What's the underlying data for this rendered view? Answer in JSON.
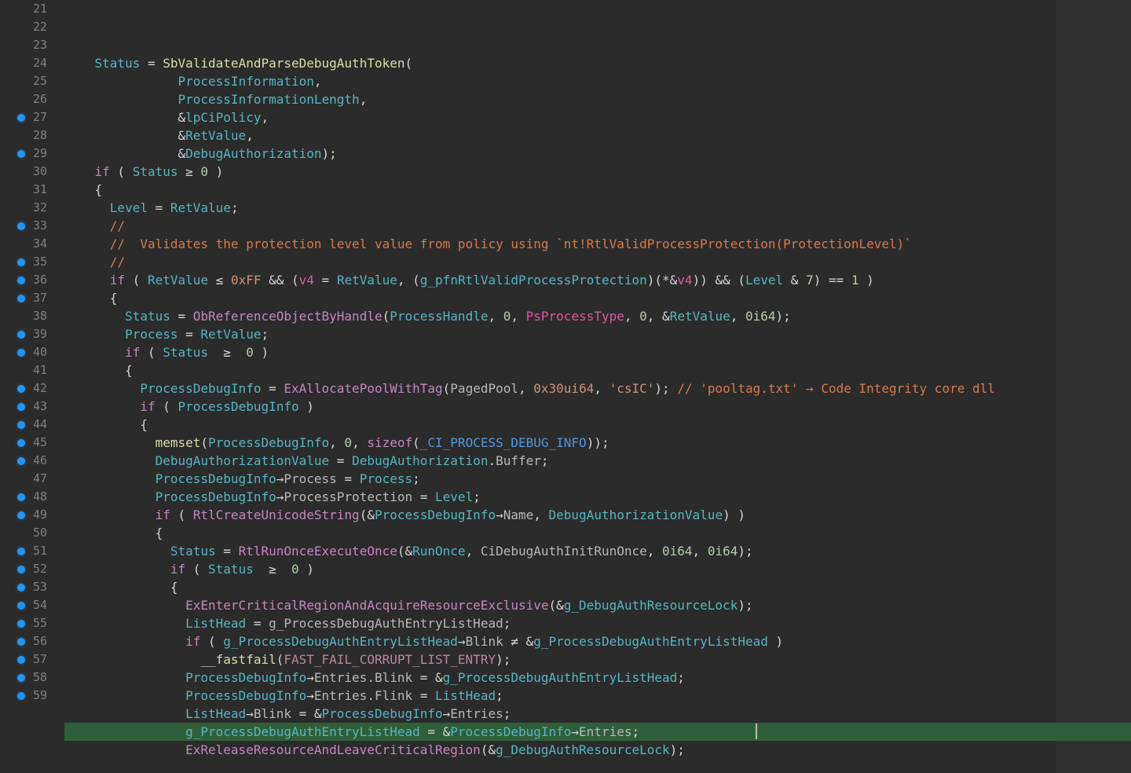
{
  "editor": {
    "firstLine": 21,
    "highlightedLine": 58,
    "lines": [
      {
        "n": 21,
        "bp": false,
        "tokens": [
          [
            "    ",
            "c-default"
          ],
          [
            "Status",
            "c-id"
          ],
          [
            " = ",
            "c-op"
          ],
          [
            "SbValidateAndParseDebugAuthToken",
            "c-fn"
          ],
          [
            "(",
            "c-white"
          ]
        ]
      },
      {
        "n": 22,
        "bp": false,
        "tokens": [
          [
            "               ",
            "c-default"
          ],
          [
            "ProcessInformation",
            "c-id"
          ],
          [
            ",",
            "c-white"
          ]
        ]
      },
      {
        "n": 23,
        "bp": false,
        "tokens": [
          [
            "               ",
            "c-default"
          ],
          [
            "ProcessInformationLength",
            "c-id"
          ],
          [
            ",",
            "c-white"
          ]
        ]
      },
      {
        "n": 24,
        "bp": false,
        "tokens": [
          [
            "               &",
            "c-white"
          ],
          [
            "lpCiPolicy",
            "c-id"
          ],
          [
            ",",
            "c-white"
          ]
        ]
      },
      {
        "n": 25,
        "bp": false,
        "tokens": [
          [
            "               &",
            "c-white"
          ],
          [
            "RetValue",
            "c-id"
          ],
          [
            ",",
            "c-white"
          ]
        ]
      },
      {
        "n": 26,
        "bp": false,
        "tokens": [
          [
            "               &",
            "c-white"
          ],
          [
            "DebugAuthorization",
            "c-id"
          ],
          [
            ");",
            "c-white"
          ]
        ]
      },
      {
        "n": 27,
        "bp": true,
        "tokens": [
          [
            "    ",
            "c-default"
          ],
          [
            "if",
            "c-kw"
          ],
          [
            " ( ",
            "c-white"
          ],
          [
            "Status",
            "c-id"
          ],
          [
            " ≥ ",
            "c-op"
          ],
          [
            "0",
            "c-num"
          ],
          [
            " )",
            "c-white"
          ]
        ]
      },
      {
        "n": 28,
        "bp": false,
        "tokens": [
          [
            "    {",
            "c-white"
          ]
        ]
      },
      {
        "n": 29,
        "bp": true,
        "tokens": [
          [
            "      ",
            "c-default"
          ],
          [
            "Level",
            "c-id"
          ],
          [
            " = ",
            "c-op"
          ],
          [
            "RetValue",
            "c-id"
          ],
          [
            ";",
            "c-white"
          ]
        ]
      },
      {
        "n": 30,
        "bp": false,
        "tokens": [
          [
            "      ",
            "c-default"
          ],
          [
            "//",
            "c-cmt2"
          ]
        ]
      },
      {
        "n": 31,
        "bp": false,
        "tokens": [
          [
            "      ",
            "c-default"
          ],
          [
            "//  Validates the protection level value from policy using `nt!RtlValidProcessProtection(ProtectionLevel)`",
            "c-cmt2"
          ]
        ]
      },
      {
        "n": 32,
        "bp": false,
        "tokens": [
          [
            "      ",
            "c-default"
          ],
          [
            "//",
            "c-cmt2"
          ]
        ]
      },
      {
        "n": 33,
        "bp": true,
        "tokens": [
          [
            "      ",
            "c-default"
          ],
          [
            "if",
            "c-kw"
          ],
          [
            " ( ",
            "c-white"
          ],
          [
            "RetValue",
            "c-id"
          ],
          [
            " ≤ ",
            "c-op"
          ],
          [
            "0xFF",
            "c-hex"
          ],
          [
            " && (",
            "c-white"
          ],
          [
            "v4",
            "c-var"
          ],
          [
            " = ",
            "c-op"
          ],
          [
            "RetValue",
            "c-id"
          ],
          [
            ", (",
            "c-white"
          ],
          [
            "g_pfnRtlValidProcessProtection",
            "c-id"
          ],
          [
            ")(*&",
            "c-white"
          ],
          [
            "v4",
            "c-var"
          ],
          [
            ")) && (",
            "c-white"
          ],
          [
            "Level",
            "c-id"
          ],
          [
            " & ",
            "c-op"
          ],
          [
            "7",
            "c-num"
          ],
          [
            ") == ",
            "c-op"
          ],
          [
            "1",
            "c-num"
          ],
          [
            " )",
            "c-white"
          ]
        ]
      },
      {
        "n": 34,
        "bp": false,
        "tokens": [
          [
            "      {",
            "c-white"
          ]
        ]
      },
      {
        "n": 35,
        "bp": true,
        "tokens": [
          [
            "        ",
            "c-default"
          ],
          [
            "Status",
            "c-id"
          ],
          [
            " = ",
            "c-op"
          ],
          [
            "ObReferenceObjectByHandle",
            "c-fnp"
          ],
          [
            "(",
            "c-white"
          ],
          [
            "ProcessHandle",
            "c-id"
          ],
          [
            ", ",
            "c-white"
          ],
          [
            "0",
            "c-num"
          ],
          [
            ", ",
            "c-white"
          ],
          [
            "PsProcessType",
            "c-var"
          ],
          [
            ", ",
            "c-white"
          ],
          [
            "0",
            "c-num"
          ],
          [
            ", &",
            "c-white"
          ],
          [
            "RetValue",
            "c-id"
          ],
          [
            ", ",
            "c-white"
          ],
          [
            "0i64",
            "c-num"
          ],
          [
            ");",
            "c-white"
          ]
        ]
      },
      {
        "n": 36,
        "bp": true,
        "tokens": [
          [
            "        ",
            "c-default"
          ],
          [
            "Process",
            "c-id"
          ],
          [
            " = ",
            "c-op"
          ],
          [
            "RetValue",
            "c-id"
          ],
          [
            ";",
            "c-white"
          ]
        ]
      },
      {
        "n": 37,
        "bp": true,
        "tokens": [
          [
            "        ",
            "c-default"
          ],
          [
            "if",
            "c-kw"
          ],
          [
            " ( ",
            "c-white"
          ],
          [
            "Status",
            "c-id"
          ],
          [
            "  ≥  ",
            "c-op"
          ],
          [
            "0",
            "c-num"
          ],
          [
            " )",
            "c-white"
          ]
        ]
      },
      {
        "n": 38,
        "bp": false,
        "tokens": [
          [
            "        {",
            "c-white"
          ]
        ]
      },
      {
        "n": 39,
        "bp": true,
        "tokens": [
          [
            "          ",
            "c-default"
          ],
          [
            "ProcessDebugInfo",
            "c-id"
          ],
          [
            " = ",
            "c-op"
          ],
          [
            "ExAllocatePoolWithTag",
            "c-fnp"
          ],
          [
            "(",
            "c-white"
          ],
          [
            "PagedPool",
            "c-member"
          ],
          [
            ", ",
            "c-white"
          ],
          [
            "0x30ui64",
            "c-hex"
          ],
          [
            ", ",
            "c-white"
          ],
          [
            "'csIC'",
            "c-str"
          ],
          [
            ");",
            "c-white"
          ],
          [
            " // 'pooltag.txt' → Code Integrity core dll",
            "c-cmt2"
          ]
        ]
      },
      {
        "n": 40,
        "bp": true,
        "tokens": [
          [
            "          ",
            "c-default"
          ],
          [
            "if",
            "c-kw"
          ],
          [
            " ( ",
            "c-white"
          ],
          [
            "ProcessDebugInfo",
            "c-id"
          ],
          [
            " )",
            "c-white"
          ]
        ]
      },
      {
        "n": 41,
        "bp": false,
        "tokens": [
          [
            "          {",
            "c-white"
          ]
        ]
      },
      {
        "n": 42,
        "bp": true,
        "tokens": [
          [
            "            ",
            "c-default"
          ],
          [
            "memset",
            "c-fn"
          ],
          [
            "(",
            "c-white"
          ],
          [
            "ProcessDebugInfo",
            "c-id"
          ],
          [
            ", ",
            "c-white"
          ],
          [
            "0",
            "c-num"
          ],
          [
            ", ",
            "c-white"
          ],
          [
            "sizeof",
            "c-kw"
          ],
          [
            "(",
            "c-white"
          ],
          [
            "_CI_PROCESS_DEBUG_INFO",
            "c-const"
          ],
          [
            "));",
            "c-white"
          ]
        ]
      },
      {
        "n": 43,
        "bp": true,
        "tokens": [
          [
            "            ",
            "c-default"
          ],
          [
            "DebugAuthorizationValue",
            "c-id"
          ],
          [
            " = ",
            "c-op"
          ],
          [
            "DebugAuthorization",
            "c-id"
          ],
          [
            ".",
            "c-white"
          ],
          [
            "Buffer",
            "c-member"
          ],
          [
            ";",
            "c-white"
          ]
        ]
      },
      {
        "n": 44,
        "bp": true,
        "tokens": [
          [
            "            ",
            "c-default"
          ],
          [
            "ProcessDebugInfo",
            "c-id"
          ],
          [
            "→",
            "c-op"
          ],
          [
            "Process",
            "c-member"
          ],
          [
            " = ",
            "c-op"
          ],
          [
            "Process",
            "c-id"
          ],
          [
            ";",
            "c-white"
          ]
        ]
      },
      {
        "n": 45,
        "bp": true,
        "tokens": [
          [
            "            ",
            "c-default"
          ],
          [
            "ProcessDebugInfo",
            "c-id"
          ],
          [
            "→",
            "c-op"
          ],
          [
            "ProcessProtection",
            "c-member"
          ],
          [
            " = ",
            "c-op"
          ],
          [
            "Level",
            "c-id"
          ],
          [
            ";",
            "c-white"
          ]
        ]
      },
      {
        "n": 46,
        "bp": true,
        "tokens": [
          [
            "            ",
            "c-default"
          ],
          [
            "if",
            "c-kw"
          ],
          [
            " ( ",
            "c-white"
          ],
          [
            "RtlCreateUnicodeString",
            "c-fnp"
          ],
          [
            "(&",
            "c-white"
          ],
          [
            "ProcessDebugInfo",
            "c-id"
          ],
          [
            "→",
            "c-op"
          ],
          [
            "Name",
            "c-member"
          ],
          [
            ", ",
            "c-white"
          ],
          [
            "DebugAuthorizationValue",
            "c-id"
          ],
          [
            ") )",
            "c-white"
          ]
        ]
      },
      {
        "n": 47,
        "bp": false,
        "tokens": [
          [
            "            {",
            "c-white"
          ]
        ]
      },
      {
        "n": 48,
        "bp": true,
        "tokens": [
          [
            "              ",
            "c-default"
          ],
          [
            "Status",
            "c-id"
          ],
          [
            " = ",
            "c-op"
          ],
          [
            "RtlRunOnceExecuteOnce",
            "c-fnp"
          ],
          [
            "(&",
            "c-white"
          ],
          [
            "RunOnce",
            "c-id"
          ],
          [
            ", ",
            "c-white"
          ],
          [
            "CiDebugAuthInitRunOnce",
            "c-member"
          ],
          [
            ", ",
            "c-white"
          ],
          [
            "0i64",
            "c-num"
          ],
          [
            ", ",
            "c-white"
          ],
          [
            "0i64",
            "c-num"
          ],
          [
            ");",
            "c-white"
          ]
        ]
      },
      {
        "n": 49,
        "bp": true,
        "tokens": [
          [
            "              ",
            "c-default"
          ],
          [
            "if",
            "c-kw"
          ],
          [
            " ( ",
            "c-white"
          ],
          [
            "Status",
            "c-id"
          ],
          [
            "  ≥  ",
            "c-op"
          ],
          [
            "0",
            "c-num"
          ],
          [
            " )",
            "c-white"
          ]
        ]
      },
      {
        "n": 50,
        "bp": false,
        "tokens": [
          [
            "              {",
            "c-white"
          ]
        ]
      },
      {
        "n": 51,
        "bp": true,
        "tokens": [
          [
            "                ",
            "c-default"
          ],
          [
            "ExEnterCriticalRegionAndAcquireResourceExclusive",
            "c-fnp"
          ],
          [
            "(&",
            "c-white"
          ],
          [
            "g_DebugAuthResourceLock",
            "c-id"
          ],
          [
            ");",
            "c-white"
          ]
        ]
      },
      {
        "n": 52,
        "bp": true,
        "tokens": [
          [
            "                ",
            "c-default"
          ],
          [
            "ListHead",
            "c-id"
          ],
          [
            " = ",
            "c-op"
          ],
          [
            "g_ProcessDebugAuthEntryListHead",
            "c-member"
          ],
          [
            ";",
            "c-white"
          ]
        ]
      },
      {
        "n": 53,
        "bp": true,
        "tokens": [
          [
            "                ",
            "c-default"
          ],
          [
            "if",
            "c-kw"
          ],
          [
            " ( ",
            "c-white"
          ],
          [
            "g_ProcessDebugAuthEntryListHead",
            "c-id"
          ],
          [
            "→",
            "c-op"
          ],
          [
            "Blink",
            "c-member"
          ],
          [
            " ≠ &",
            "c-op"
          ],
          [
            "g_ProcessDebugAuthEntryListHead",
            "c-id"
          ],
          [
            " )",
            "c-white"
          ]
        ]
      },
      {
        "n": 54,
        "bp": true,
        "tokens": [
          [
            "                  ",
            "c-default"
          ],
          [
            "__fastfail",
            "c-fn"
          ],
          [
            "(",
            "c-white"
          ],
          [
            "FAST_FAIL_CORRUPT_LIST_ENTRY",
            "c-macro"
          ],
          [
            ");",
            "c-white"
          ]
        ]
      },
      {
        "n": 55,
        "bp": true,
        "tokens": [
          [
            "                ",
            "c-default"
          ],
          [
            "ProcessDebugInfo",
            "c-id"
          ],
          [
            "→",
            "c-op"
          ],
          [
            "Entries.Blink",
            "c-member"
          ],
          [
            " = &",
            "c-op"
          ],
          [
            "g_ProcessDebugAuthEntryListHead",
            "c-id"
          ],
          [
            ";",
            "c-white"
          ]
        ]
      },
      {
        "n": 56,
        "bp": true,
        "tokens": [
          [
            "                ",
            "c-default"
          ],
          [
            "ProcessDebugInfo",
            "c-id"
          ],
          [
            "→",
            "c-op"
          ],
          [
            "Entries.Flink",
            "c-member"
          ],
          [
            " = ",
            "c-op"
          ],
          [
            "ListHead",
            "c-id"
          ],
          [
            ";",
            "c-white"
          ]
        ]
      },
      {
        "n": 57,
        "bp": true,
        "tokens": [
          [
            "                ",
            "c-default"
          ],
          [
            "ListHead",
            "c-id"
          ],
          [
            "→",
            "c-op"
          ],
          [
            "Blink",
            "c-member"
          ],
          [
            " = &",
            "c-op"
          ],
          [
            "ProcessDebugInfo",
            "c-id"
          ],
          [
            "→",
            "c-op"
          ],
          [
            "Entries",
            "c-member"
          ],
          [
            ";",
            "c-white"
          ]
        ]
      },
      {
        "n": 58,
        "bp": true,
        "tokens": [
          [
            "                ",
            "c-default"
          ],
          [
            "g_ProcessDebugAuthEntryListHead",
            "c-id"
          ],
          [
            " = &",
            "c-op"
          ],
          [
            "ProcessDebugInfo",
            "c-id"
          ],
          [
            "→",
            "c-op"
          ],
          [
            "Entries",
            "c-member"
          ],
          [
            ";",
            "c-white"
          ]
        ]
      },
      {
        "n": 59,
        "bp": true,
        "tokens": [
          [
            "                ",
            "c-default"
          ],
          [
            "ExReleaseResourceAndLeaveCriticalRegion",
            "c-fnp"
          ],
          [
            "(&",
            "c-white"
          ],
          [
            "g_DebugAuthResourceLock",
            "c-id"
          ],
          [
            ");",
            "c-white"
          ]
        ]
      }
    ]
  }
}
